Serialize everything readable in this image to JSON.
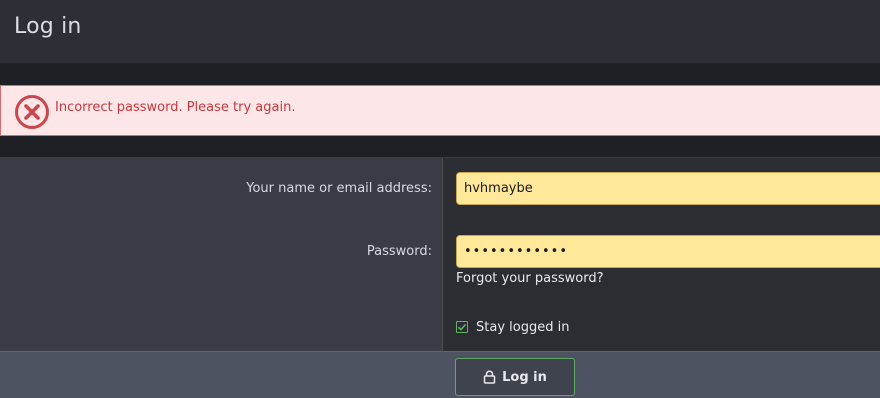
{
  "header": {
    "title": "Log in"
  },
  "error": {
    "icon": "error-circle-x-icon",
    "message": "Incorrect password. Please try again.",
    "color": "#c0393f",
    "background": "#fce6e7"
  },
  "form": {
    "username": {
      "label": "Your name or email address:",
      "value": "hvhmaybe"
    },
    "password": {
      "label": "Password:",
      "value": "••••••••••••"
    },
    "forgot_link": "Forgot your password?",
    "stay_logged_in": {
      "label": "Stay logged in",
      "checked": true
    }
  },
  "submit": {
    "label": "Log in",
    "icon": "lock-icon",
    "accent": "#5fa85f"
  },
  "colors": {
    "input_background": "#ffe899",
    "panel": "#2b2d33",
    "label_panel": "#393c44",
    "footer": "#4e5361"
  }
}
